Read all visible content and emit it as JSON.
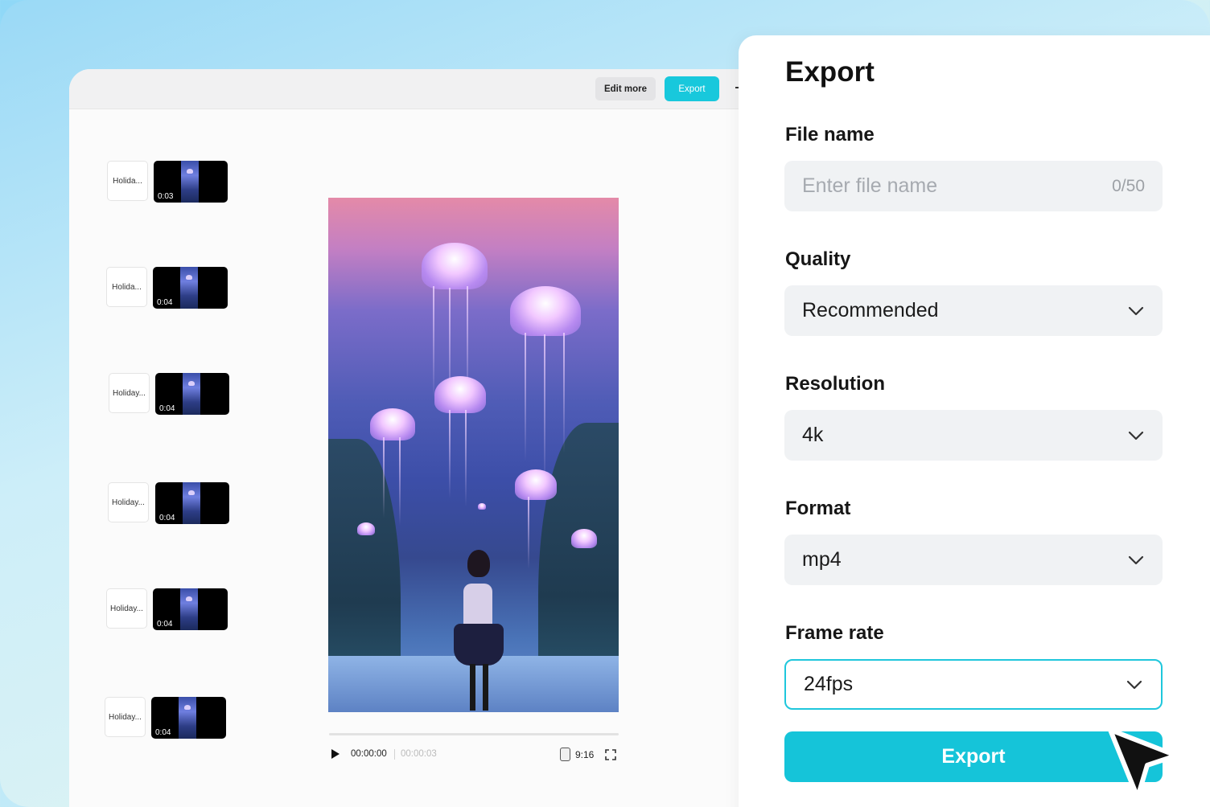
{
  "editor": {
    "edit_more_label": "Edit more",
    "export_label": "Export",
    "clips": [
      {
        "label": "Holida...",
        "duration": "0:03"
      },
      {
        "label": "Holida...",
        "duration": "0:04"
      },
      {
        "label": "Holiday...",
        "duration": "0:04"
      },
      {
        "label": "Holiday...",
        "duration": "0:04"
      },
      {
        "label": "Holiday...",
        "duration": "0:04"
      },
      {
        "label": "Holiday...",
        "duration": "0:04"
      }
    ],
    "player": {
      "current_time": "00:00:00",
      "total_time": "00:00:03",
      "aspect_ratio": "9:16",
      "progress": 0
    }
  },
  "export_panel": {
    "title": "Export",
    "file_name": {
      "label": "File name",
      "placeholder": "Enter file name",
      "value": "",
      "count": "0/50"
    },
    "quality": {
      "label": "Quality",
      "value": "Recommended"
    },
    "resolution": {
      "label": "Resolution",
      "value": "4k"
    },
    "format": {
      "label": "Format",
      "value": "mp4"
    },
    "frame_rate": {
      "label": "Frame rate",
      "value": "24fps"
    },
    "export_button_label": "Export"
  },
  "colors": {
    "accent": "#15c4d9",
    "field_bg": "#f0f2f4",
    "active_border": "#1fc7dc"
  },
  "icons": [
    "play-icon",
    "aspect-ratio-icon",
    "fullscreen-icon",
    "chevron-down-icon",
    "cursor-pointer-icon"
  ]
}
